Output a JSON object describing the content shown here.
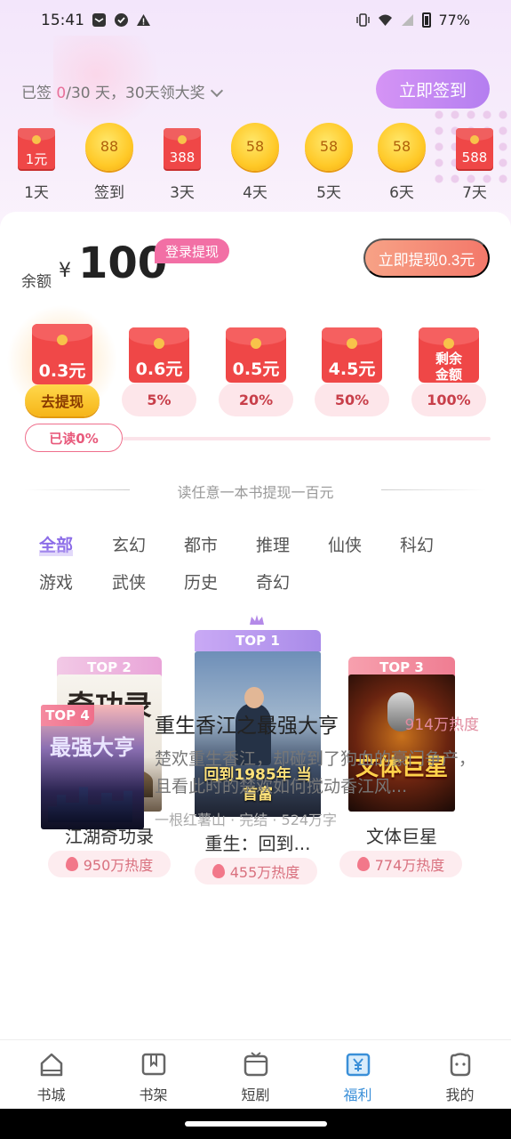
{
  "status": {
    "time": "15:41",
    "battery": "77%"
  },
  "signin": {
    "prefix": "已签 ",
    "current": "0",
    "suffix": "/30 天，30天领大奖",
    "button": "立即签到",
    "days": [
      {
        "type": "redpack",
        "value": "1元",
        "label": "1天"
      },
      {
        "type": "coin",
        "value": "88",
        "label": "签到"
      },
      {
        "type": "redpack",
        "value": "388",
        "label": "3天"
      },
      {
        "type": "coin",
        "value": "58",
        "label": "4天"
      },
      {
        "type": "coin",
        "value": "58",
        "label": "5天"
      },
      {
        "type": "coin",
        "value": "58",
        "label": "6天"
      },
      {
        "type": "redpack",
        "value": "588",
        "label": "7天"
      }
    ]
  },
  "balance": {
    "label": "余额",
    "currency": "¥",
    "value": "100",
    "login_tag": "登录提现",
    "withdraw_button": "立即提现0.3元"
  },
  "tiers": [
    {
      "amount": "0.3元",
      "pill": "去提现",
      "active": true
    },
    {
      "amount": "0.6元",
      "pill": "5%"
    },
    {
      "amount": "0.5元",
      "pill": "20%"
    },
    {
      "amount": "4.5元",
      "pill": "50%"
    },
    {
      "amount": "剩余金额",
      "pill": "100%"
    }
  ],
  "read_progress": "已读0%",
  "section_title": "读任意一本书提现一百元",
  "categories": [
    "全部",
    "玄幻",
    "都市",
    "推理",
    "仙侠",
    "科幻",
    "游戏",
    "武侠",
    "历史",
    "奇幻"
  ],
  "top_books": [
    {
      "rank": "TOP 2",
      "title": "江湖奇功录",
      "heat": "950万热度",
      "cover_text": "奇功录"
    },
    {
      "rank": "TOP 1",
      "title": "重生：回到...",
      "heat": "455万热度",
      "cover_text": "回到1985年 当首富"
    },
    {
      "rank": "TOP 3",
      "title": "文体巨星",
      "heat": "774万热度",
      "cover_text": "文体巨星"
    }
  ],
  "list_book": {
    "rank": "TOP 4",
    "title": "重生香江之最强大亨",
    "heat": "914万热度",
    "desc": "楚欢重生香江，却碰到了狗血的豪门争产，且看此时的楚欢如何搅动香江风...",
    "meta": "一根红薯山 · 完结 · 524万字",
    "cover_text": "最强大亨"
  },
  "nav": [
    {
      "label": "书城",
      "icon": "home-icon"
    },
    {
      "label": "书架",
      "icon": "bookshelf-icon"
    },
    {
      "label": "短剧",
      "icon": "tv-icon"
    },
    {
      "label": "福利",
      "icon": "yen-icon",
      "active": true
    },
    {
      "label": "我的",
      "icon": "profile-icon"
    }
  ],
  "colors": {
    "accent": "#b47ef0",
    "red": "#ef4747",
    "pink": "#f26fa5",
    "nav_active": "#3a8fd8"
  }
}
